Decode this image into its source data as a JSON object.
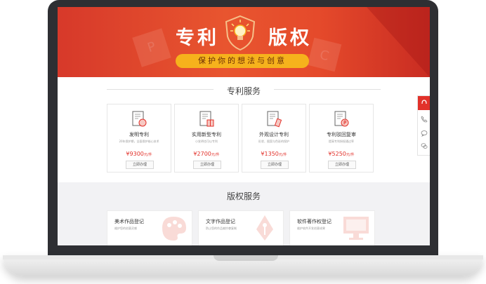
{
  "banner": {
    "title_left": "专利",
    "title_right": "版权",
    "slogan": "保护你的想法与创意",
    "deco_left_letter": "P",
    "deco_right_letter": "C"
  },
  "patent_section": {
    "title": "专利服务",
    "cards": [
      {
        "name": "发明专利",
        "desc": "20年保护期，全面保护核心技术",
        "price": "¥9300",
        "unit": "元/件",
        "button": "立即办理",
        "icon": "patent-doc-bulb-icon"
      },
      {
        "name": "实用新型专利",
        "desc": "小发明也可以专利",
        "price": "¥2700",
        "unit": "元/件",
        "button": "立即办理",
        "icon": "patent-doc-gift-icon"
      },
      {
        "name": "外观设计专利",
        "desc": "形状、图案与色彩的保护",
        "price": "¥1350",
        "unit": "元/件",
        "button": "立即办理",
        "icon": "patent-doc-brush-icon"
      },
      {
        "name": "专利驳回复审",
        "desc": "提高专利授权通过率",
        "price": "¥5250",
        "unit": "元/件",
        "button": "立即办理",
        "icon": "patent-doc-p-icon"
      }
    ]
  },
  "copyright_section": {
    "title": "版权服务",
    "cards": [
      {
        "name": "美术作品登记",
        "desc": "维护您的创意灵感",
        "icon": "palette-icon"
      },
      {
        "name": "文字作品登记",
        "desc": "防止您的作品被抄袭复制",
        "icon": "pen-nib-icon"
      },
      {
        "name": "软件著作权登记",
        "desc": "维护软件开发创意成果",
        "icon": "monitor-icon"
      }
    ]
  },
  "colors": {
    "brand_red": "#e2312a",
    "slogan_yellow": "#f6b21c"
  }
}
